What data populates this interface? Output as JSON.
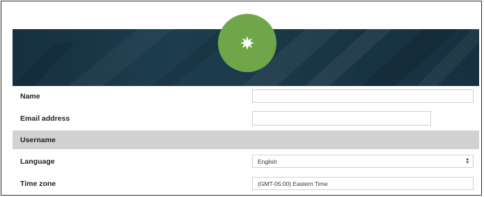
{
  "profile": {
    "avatar_icon": "star-burst-icon",
    "colors": {
      "banner": "#1a3747",
      "avatar": "#6fa64a",
      "shaded_row": "#d2d2d2"
    }
  },
  "form": {
    "name_label": "Name",
    "name_value": "",
    "email_label": "Email address",
    "email_value": "",
    "username_label": "Username",
    "language_label": "Language",
    "language_value": "English",
    "timezone_label": "Time zone",
    "timezone_value": "(GMT-05:00) Eastern Time"
  }
}
